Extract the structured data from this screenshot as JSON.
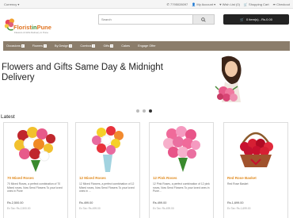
{
  "topbar": {
    "currency": "Currency",
    "links": [
      {
        "icon": "phone-icon",
        "label": "7795028097"
      },
      {
        "icon": "user-icon",
        "label": "My Account"
      },
      {
        "icon": "heart-icon",
        "label": "Wish List (0)"
      },
      {
        "icon": "cart-icon",
        "label": "Shopping Cart"
      },
      {
        "icon": "share-icon",
        "label": "Checkout"
      }
    ]
  },
  "logo": {
    "brand_a": "Florist",
    "brand_b": "in",
    "brand_c": "Pune",
    "tagline": "Flowers & Gifts Delivery in Pune"
  },
  "search": {
    "placeholder": "Search"
  },
  "cart": {
    "label": "0 item(s) - Rs.0.00"
  },
  "nav": {
    "items": [
      {
        "label": "Occasions",
        "has_dropdown": true
      },
      {
        "label": "Flowers",
        "has_dropdown": true
      },
      {
        "label": "By Design",
        "has_dropdown": true
      },
      {
        "label": "Combos",
        "has_dropdown": true
      },
      {
        "label": "Gifts",
        "has_dropdown": true
      },
      {
        "label": "Cakes",
        "has_dropdown": false
      },
      {
        "label": "Engage Offer",
        "has_dropdown": false
      }
    ]
  },
  "banner": {
    "headline": "Flowers and Gifts Same Day & Midnight Delivery",
    "slides": 3,
    "active_slide": 3
  },
  "section_title": "Latest",
  "products": [
    {
      "name": "70 Mixed Roses",
      "desc": "70 Mixed Roses, a perfect combination of 70 Mixed roses, Now Send Flowers To your loved ones in Pune",
      "price": "Rs.2,500.00",
      "extax": "Ex Tax: Rs.2,500.00",
      "colors": [
        "#c0272d",
        "#f2c12e",
        "#e75a8a",
        "#ffffff",
        "#f08a24"
      ]
    },
    {
      "name": "12 Mixed Roses",
      "desc": "12 Mixed Flowers, a perfect combination of 12 Mixed roses, Now Send Flowers To your loved ones in ...",
      "price": "Rs.499.00",
      "extax": "Ex Tax: Rs.499.00",
      "colors": [
        "#e8323c",
        "#f5d02a",
        "#f28a2e",
        "#ffffff",
        "#e86aa0"
      ]
    },
    {
      "name": "12 Pink Roses",
      "desc": "12 Pink Roses, a perfect combination of 12 pink roses, Now Send Flowers To your loved ones in Pune...",
      "price": "Rs.499.00",
      "extax": "Ex Tax: Rs.499.00",
      "colors": [
        "#f06a9a",
        "#f59ac0",
        "#e85589",
        "#f7b0cb",
        "#ea6fa0"
      ]
    },
    {
      "name": "Red Rose Basket",
      "desc": "Red Rose Basket",
      "price": "Rs.1,699.00",
      "extax": "Ex Tax: Rs.1,699.00",
      "colors": [
        "#c8102e",
        "#d61f33",
        "#b00b24",
        "#e02a3c",
        "#c41230"
      ]
    }
  ]
}
